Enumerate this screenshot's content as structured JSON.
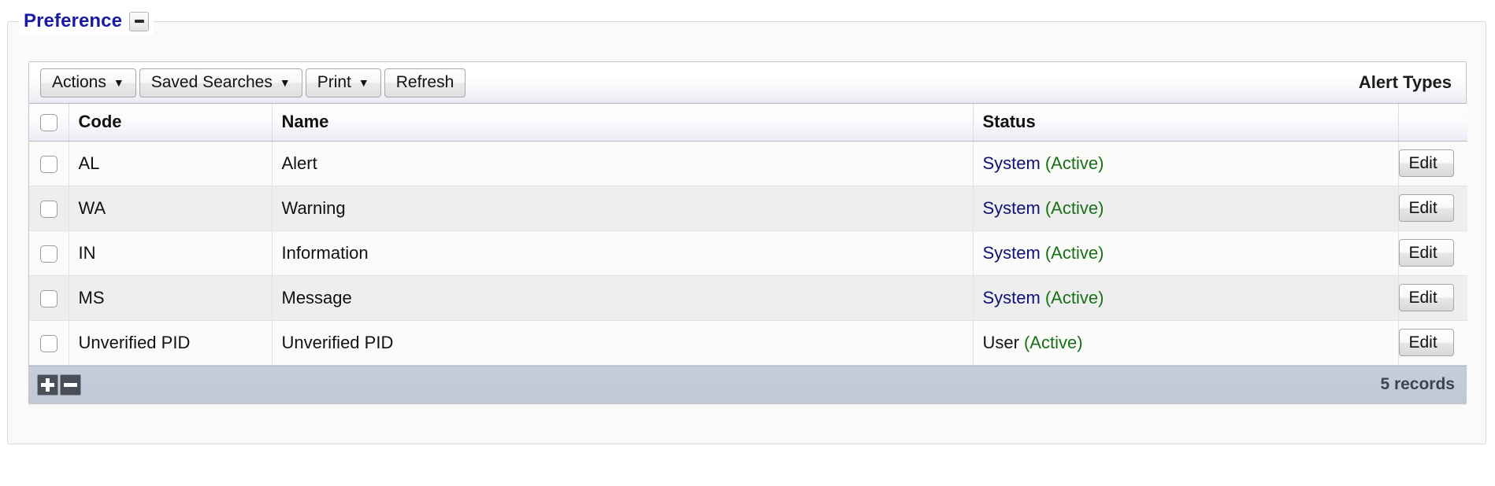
{
  "region": {
    "title": "Preference",
    "collapse_icon": "minus-icon"
  },
  "report": {
    "title": "Alert Types",
    "toolbar": {
      "buttons": [
        {
          "label": "Actions",
          "caret": "▼",
          "has_caret": true
        },
        {
          "label": "Saved Searches",
          "caret": "▼",
          "has_caret": true
        },
        {
          "label": "Print",
          "caret": "▼",
          "has_caret": true
        },
        {
          "label": "Refresh",
          "caret": "",
          "has_caret": false
        }
      ]
    },
    "columns": [
      {
        "key": "check",
        "label": ""
      },
      {
        "key": "code",
        "label": "Code"
      },
      {
        "key": "name",
        "label": "Name"
      },
      {
        "key": "status",
        "label": "Status"
      },
      {
        "key": "edit",
        "label": ""
      }
    ],
    "rows": [
      {
        "code": "AL",
        "name": "Alert",
        "status_owner": "System",
        "status_state": "(Active)",
        "owner_type": "system",
        "edit_label": "Edit"
      },
      {
        "code": "WA",
        "name": "Warning",
        "status_owner": "System",
        "status_state": "(Active)",
        "owner_type": "system",
        "edit_label": "Edit"
      },
      {
        "code": "IN",
        "name": "Information",
        "status_owner": "System",
        "status_state": "(Active)",
        "owner_type": "system",
        "edit_label": "Edit"
      },
      {
        "code": "MS",
        "name": "Message",
        "status_owner": "System",
        "status_state": "(Active)",
        "owner_type": "system",
        "edit_label": "Edit"
      },
      {
        "code": "Unverified PID",
        "name": "Unverified PID",
        "status_owner": "User",
        "status_state": "(Active)",
        "owner_type": "user",
        "edit_label": "Edit"
      }
    ],
    "footer": {
      "add_icon": "plus-icon",
      "remove_icon": "minus-icon",
      "record_count": "5 records"
    }
  },
  "colors": {
    "region_title": "#1a1aa6",
    "status_system": "#10107a",
    "status_user": "#151515",
    "status_active": "#177017",
    "footer_bar": "#c1cad8"
  }
}
